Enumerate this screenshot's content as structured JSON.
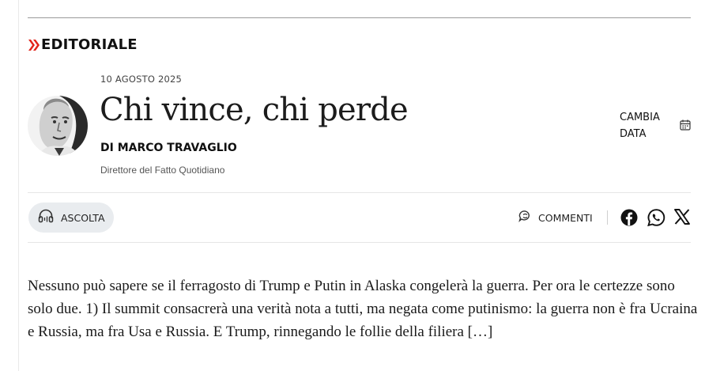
{
  "section": {
    "label": "EDITORIALE",
    "accent_color": "#e2231a",
    "icon": "double-chevron-right-icon"
  },
  "article": {
    "date": "10 AGOSTO 2025",
    "title": "Chi vince, chi perde",
    "author": "DI MARCO TRAVAGLIO",
    "author_role": "Direttore del Fatto Quotidiano",
    "excerpt": "Nessuno può sapere se il ferragosto di Trump e Putin in Alaska congelerà la guerra. Per ora le certezze sono solo due. 1) Il summit consacrerà una verità nota a tutti, ma negata come putinismo: la guerra non è fra Ucraina e Russia, ma fra Usa e Russia. E Trump, rinnegando le follie della filiera […]"
  },
  "date_picker": {
    "label": "CAMBIA DATA",
    "icon": "calendar-icon"
  },
  "toolbar": {
    "listen_label": "ASCOLTA",
    "listen_icon": "headphones-icon",
    "comments_label": "COMMENTI",
    "comments_icon": "comment-icon",
    "share_icons": [
      "facebook-icon",
      "whatsapp-icon",
      "x-icon"
    ]
  }
}
